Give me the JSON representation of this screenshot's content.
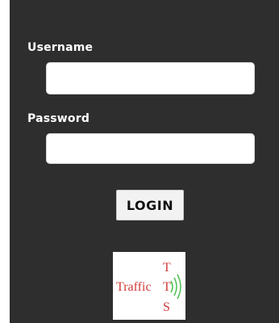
{
  "form": {
    "username_label": "Username",
    "username_value": "",
    "password_label": "Password",
    "password_value": "",
    "login_label": "LOGIN"
  },
  "logo": {
    "word": "Traffic",
    "letter_top": "T",
    "letter_middle": "T",
    "letter_bottom": "S",
    "waves_icon": "signal-waves-icon"
  },
  "colors": {
    "panel_background": "#2e2e2e",
    "logo_red": "#d23a3a",
    "logo_green": "#4cbf4c"
  }
}
